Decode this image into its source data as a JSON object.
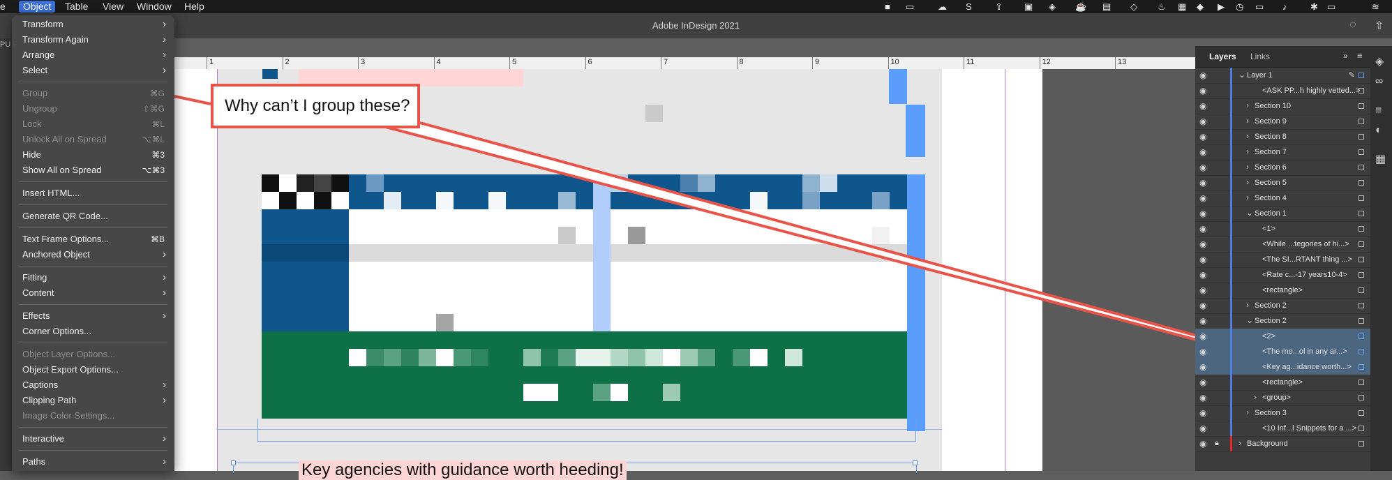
{
  "menubar": {
    "items": [
      {
        "label": "e"
      },
      {
        "label": "Object"
      },
      {
        "label": "Table"
      },
      {
        "label": "View"
      },
      {
        "label": "Window"
      },
      {
        "label": "Help"
      }
    ]
  },
  "titlebar": {
    "title": "Adobe InDesign 2021",
    "left_tag": "PU F"
  },
  "ruler": {
    "labels": [
      "1",
      "2",
      "3",
      "4",
      "5",
      "6",
      "7",
      "8",
      "9",
      "10",
      "11",
      "12",
      "13"
    ]
  },
  "callout": {
    "text": "Why can’t I group these?"
  },
  "bottom_text": "Key agencies with guidance worth heeding!",
  "object_menu": {
    "items": [
      {
        "label": "Transform",
        "submenu": true
      },
      {
        "label": "Transform Again",
        "submenu": true
      },
      {
        "label": "Arrange",
        "submenu": true
      },
      {
        "label": "Select",
        "submenu": true
      },
      {
        "separator": true
      },
      {
        "label": "Group",
        "shortcut": "⌘G",
        "disabled": true
      },
      {
        "label": "Ungroup",
        "shortcut": "⇧⌘G",
        "disabled": true
      },
      {
        "label": "Lock",
        "shortcut": "⌘L",
        "disabled": true
      },
      {
        "label": "Unlock All on Spread",
        "shortcut": "⌥⌘L",
        "disabled": true
      },
      {
        "label": "Hide",
        "shortcut": "⌘3"
      },
      {
        "label": "Show All on Spread",
        "shortcut": "⌥⌘3"
      },
      {
        "separator": true
      },
      {
        "label": "Insert HTML..."
      },
      {
        "separator": true
      },
      {
        "label": "Generate QR Code..."
      },
      {
        "separator": true
      },
      {
        "label": "Text Frame Options...",
        "shortcut": "⌘B"
      },
      {
        "label": "Anchored Object",
        "submenu": true
      },
      {
        "separator": true
      },
      {
        "label": "Fitting",
        "submenu": true
      },
      {
        "label": "Content",
        "submenu": true
      },
      {
        "separator": true
      },
      {
        "label": "Effects",
        "submenu": true
      },
      {
        "label": "Corner Options..."
      },
      {
        "separator": true
      },
      {
        "label": "Object Layer Options...",
        "disabled": true
      },
      {
        "label": "Object Export Options..."
      },
      {
        "label": "Captions",
        "submenu": true
      },
      {
        "label": "Clipping Path",
        "submenu": true
      },
      {
        "label": "Image Color Settings...",
        "disabled": true
      },
      {
        "separator": true
      },
      {
        "label": "Interactive",
        "submenu": true
      },
      {
        "separator": true
      },
      {
        "label": "Paths",
        "submenu": true
      }
    ]
  },
  "layers_panel": {
    "tabs": [
      "Layers",
      "Links"
    ],
    "rows": [
      {
        "name": "Layer 1",
        "indent": 0,
        "twirl": "open",
        "pen": true
      },
      {
        "name": "<ASK PP...h highly vetted...>",
        "indent": 2,
        "twirl": ""
      },
      {
        "name": "Section 10",
        "indent": 1,
        "twirl": "closed"
      },
      {
        "name": "Section 9",
        "indent": 1,
        "twirl": "closed"
      },
      {
        "name": "Section 8",
        "indent": 1,
        "twirl": "closed"
      },
      {
        "name": "Section 7",
        "indent": 1,
        "twirl": "closed"
      },
      {
        "name": "Section 6",
        "indent": 1,
        "twirl": "closed"
      },
      {
        "name": "Section 5",
        "indent": 1,
        "twirl": "closed"
      },
      {
        "name": "Section 4",
        "indent": 1,
        "twirl": "closed"
      },
      {
        "name": "Section 1",
        "indent": 1,
        "twirl": "open"
      },
      {
        "name": "<1>",
        "indent": 2,
        "twirl": ""
      },
      {
        "name": "<While ...tegories of hi...>",
        "indent": 2,
        "twirl": ""
      },
      {
        "name": "<The SI...RTANT thing ...>",
        "indent": 2,
        "twirl": ""
      },
      {
        "name": "<Rate c...-17 years10-4>",
        "indent": 2,
        "twirl": ""
      },
      {
        "name": "<rectangle>",
        "indent": 2,
        "twirl": ""
      },
      {
        "name": "Section 2",
        "indent": 1,
        "twirl": "closed"
      },
      {
        "name": "Section 2",
        "indent": 1,
        "twirl": "open"
      },
      {
        "name": "<2>",
        "indent": 2,
        "twirl": "",
        "selected": true
      },
      {
        "name": "<The mo...ol in any ar...>",
        "indent": 2,
        "twirl": "",
        "selected": true
      },
      {
        "name": "<Key ag...idance worth...>",
        "indent": 2,
        "twirl": "",
        "selected": true
      },
      {
        "name": "<rectangle>",
        "indent": 2,
        "twirl": ""
      },
      {
        "name": "<group>",
        "indent": 2,
        "twirl": "closed"
      },
      {
        "name": "Section 3",
        "indent": 1,
        "twirl": "closed"
      },
      {
        "name": "<10 Inf...l Snippets for a ...>",
        "indent": 2,
        "twirl": ""
      },
      {
        "name": "Background",
        "indent": 0,
        "twirl": "closed",
        "locked": true,
        "red": true
      }
    ]
  },
  "colors": {
    "accent_blue": "#3a6fd4",
    "callout_red": "#e9544a",
    "layer_blue": "#4f7ee6",
    "dark_blue": "#0f568c",
    "green": "#0e7047"
  }
}
